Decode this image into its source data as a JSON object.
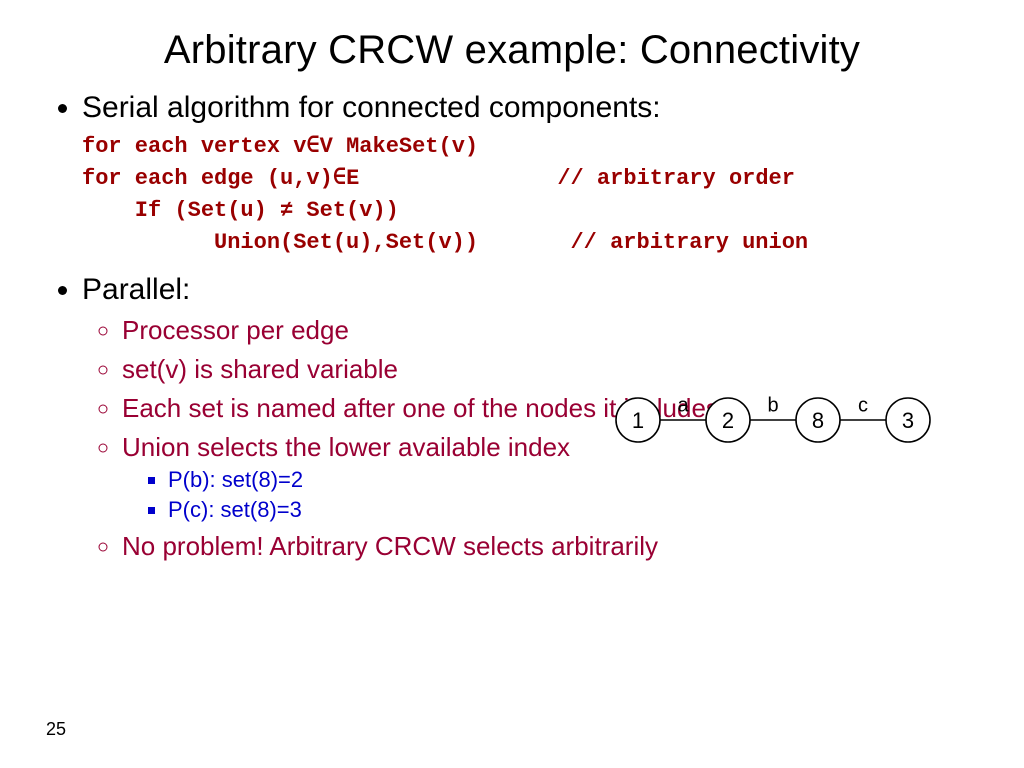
{
  "title": "Arbitrary CRCW example: Connectivity",
  "page_number": "25",
  "bullet1": "Serial algorithm for connected components:",
  "code": "for each vertex v∈V MakeSet(v)\nfor each edge (u,v)∈E               // arbitrary order\n    If (Set(u) ≠ Set(v))\n          Union(Set(u),Set(v))       // arbitrary union",
  "bullet2": "Parallel:",
  "sub": {
    "a": "Processor per edge",
    "b": "set(v) is shared variable",
    "c": "Each set is named after one of the nodes it includes",
    "d": "Union selects the lower available index",
    "e": "No problem!  Arbitrary CRCW selects arbitrarily"
  },
  "subsub": {
    "a": "P(b):  set(8)=2",
    "b": "P(c):  set(8)=3"
  },
  "graph": {
    "n1": "1",
    "n2": "2",
    "n3": "8",
    "n4": "3",
    "e1": "a",
    "e2": "b",
    "e3": "c"
  }
}
